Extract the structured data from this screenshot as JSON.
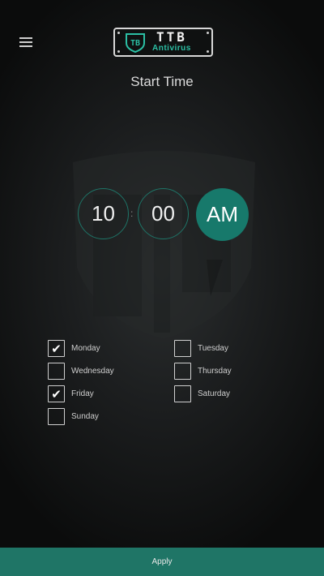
{
  "header": {
    "menu_icon": "hamburger-menu-icon",
    "logo_name": "TTB",
    "logo_sub": "Antivirus",
    "logo_mark": "TB"
  },
  "page": {
    "title": "Start Time"
  },
  "time": {
    "hour": "10",
    "separator": ":",
    "minute": "00",
    "period": "AM",
    "accent_color": "#17796b"
  },
  "days": [
    {
      "label": "Monday",
      "checked": true
    },
    {
      "label": "Tuesday",
      "checked": false
    },
    {
      "label": "Wednesday",
      "checked": false
    },
    {
      "label": "Thursday",
      "checked": false
    },
    {
      "label": "Friday",
      "checked": true
    },
    {
      "label": "Saturday",
      "checked": false
    },
    {
      "label": "Sunday",
      "checked": false
    }
  ],
  "footer": {
    "apply_label": "Apply",
    "bar_color": "#1f7566"
  }
}
